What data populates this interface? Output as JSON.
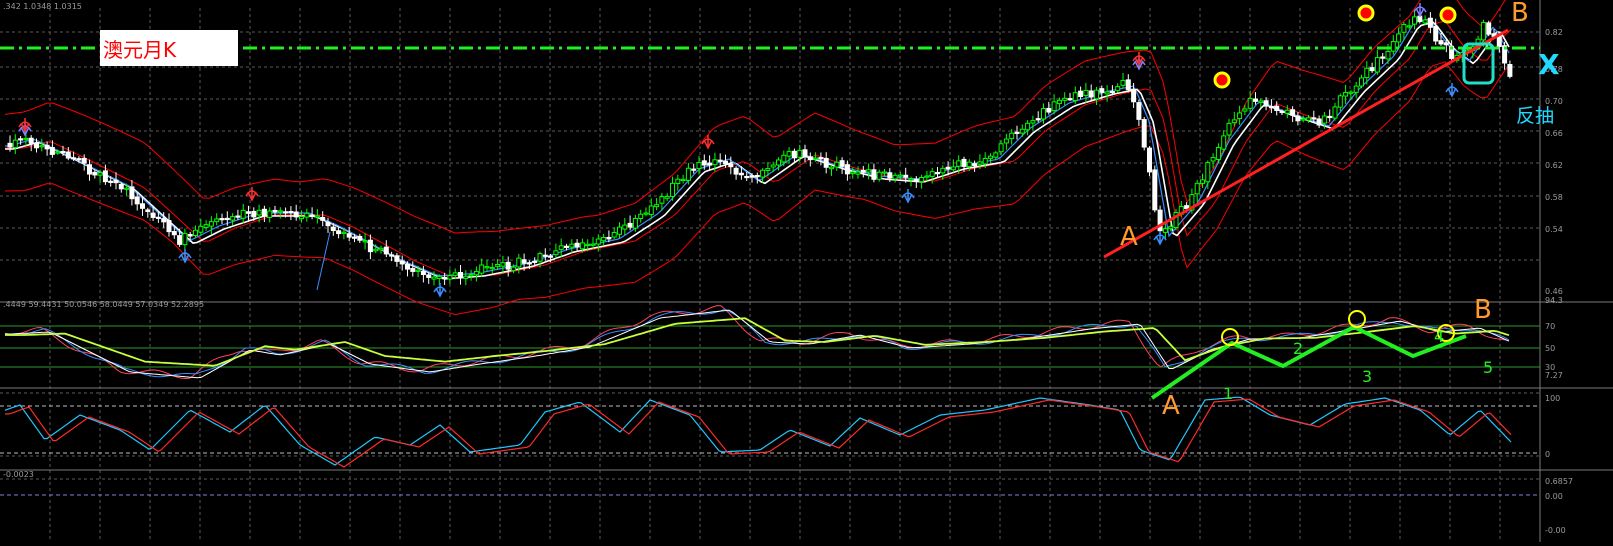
{
  "colors": {
    "background": "#000000",
    "grid": "#5a5a5a",
    "candle_up": "#00ff00",
    "candle_down": "#ffffff",
    "bollinger": "#ff0000",
    "ma_white": "#ffffff",
    "ma_blue": "#3a8fff",
    "trendline": "#ff2020",
    "green_wave": "#22ee22",
    "orange_label": "#ff9a2e",
    "cyan_label": "#22d8ff",
    "marker_red": "#ff0000",
    "marker_yellow": "#ffff00",
    "guide_green": "#2a9a2a",
    "guide_gray": "#bdbdbd"
  },
  "chart_data": [
    {
      "id": "main-price-panel",
      "type": "candlestick",
      "title": "澳元月K",
      "header": ".342 1.0348 1.0315",
      "y_ticks": [
        "0.82",
        "0.78",
        "0.70",
        "0.66",
        "0.62",
        "0.58",
        "0.54",
        "0.46"
      ],
      "annotations": [
        "A",
        "B",
        "X",
        "反抽"
      ],
      "indicators": [
        "bollinger-bands",
        "moving-averages"
      ],
      "markers": [
        "red-yellow-dots",
        "fractal-arrows"
      ]
    },
    {
      "id": "oscillator-panel",
      "type": "line",
      "header": ".4449 59.4431 50.0546 58.0449 57.0349 52.2895",
      "y_ticks": [
        "94.3",
        "70",
        "50",
        "30",
        "7.27"
      ],
      "wave_labels": [
        "A",
        "1",
        "2",
        "3",
        "4",
        "5",
        "B"
      ]
    },
    {
      "id": "stochastic-panel",
      "type": "line",
      "y_ticks": [
        "100",
        "0"
      ]
    },
    {
      "id": "bottom-panel",
      "type": "line",
      "header": "-0.0023",
      "y_ticks": [
        "0.6857",
        "0.00",
        "-0.00"
      ]
    }
  ]
}
